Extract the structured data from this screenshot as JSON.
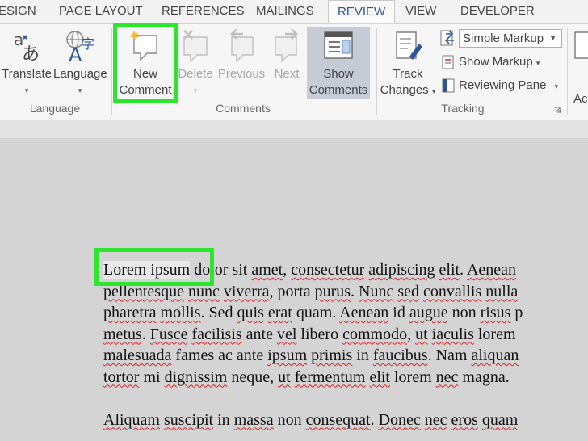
{
  "tabs": [
    "ESIGN",
    "PAGE LAYOUT",
    "REFERENCES",
    "MAILINGS",
    "REVIEW",
    "VIEW",
    "DEVELOPER"
  ],
  "active_tab": "REVIEW",
  "ribbon": {
    "language_group": {
      "label": "Language",
      "translate": "Translate",
      "language": "Language"
    },
    "comments_group": {
      "label": "Comments",
      "new_comment_line1": "New",
      "new_comment_line2": "Comment",
      "delete": "Delete",
      "previous": "Previous",
      "next": "Next",
      "show_comments_line1": "Show",
      "show_comments_line2": "Comments"
    },
    "tracking_group": {
      "label": "Tracking",
      "track_changes_line1": "Track",
      "track_changes_line2": "Changes",
      "markup_dropdown": "Simple Markup",
      "show_markup": "Show Markup",
      "reviewing_pane": "Reviewing Pane"
    },
    "cut_off_button": "Ac"
  },
  "document": {
    "paragraph1": [
      [
        {
          "t": "Lorem ipsum",
          "sel": true
        },
        {
          "t": " dolor sit "
        },
        {
          "t": "amet",
          "sq": true
        },
        {
          "t": ", "
        },
        {
          "t": "consectetur",
          "sq": true
        },
        {
          "t": " "
        },
        {
          "t": "adipiscing",
          "sq": true
        },
        {
          "t": " "
        },
        {
          "t": "elit",
          "sq": true
        },
        {
          "t": ". "
        },
        {
          "t": "Aenean",
          "sq": true
        }
      ],
      [
        {
          "t": "pellentesque",
          "sq": true
        },
        {
          "t": " "
        },
        {
          "t": "nunc",
          "sq": true
        },
        {
          "t": " "
        },
        {
          "t": "viverra",
          "sq": true
        },
        {
          "t": ", porta "
        },
        {
          "t": "purus",
          "sq": true
        },
        {
          "t": ". "
        },
        {
          "t": "Nunc",
          "sq": true
        },
        {
          "t": " "
        },
        {
          "t": "sed",
          "sq": true
        },
        {
          "t": " "
        },
        {
          "t": "convallis",
          "sq": true
        },
        {
          "t": " "
        },
        {
          "t": "nulla",
          "sq": true
        }
      ],
      [
        {
          "t": "pharetra",
          "sq": true
        },
        {
          "t": " "
        },
        {
          "t": "mollis",
          "sq": true
        },
        {
          "t": ". Sed "
        },
        {
          "t": "quis",
          "sq": true
        },
        {
          "t": " "
        },
        {
          "t": "erat",
          "sq": true
        },
        {
          "t": " quam. "
        },
        {
          "t": "Aenean",
          "sq": true
        },
        {
          "t": " id "
        },
        {
          "t": "augue",
          "sq": true
        },
        {
          "t": " non "
        },
        {
          "t": "risus",
          "sq": true
        },
        {
          "t": " p"
        }
      ],
      [
        {
          "t": "metus",
          "sq": true
        },
        {
          "t": ". "
        },
        {
          "t": "Fusce",
          "sq": true
        },
        {
          "t": " "
        },
        {
          "t": "facilisis",
          "sq": true
        },
        {
          "t": " ante "
        },
        {
          "t": "vel",
          "sq": true
        },
        {
          "t": " libero "
        },
        {
          "t": "commodo",
          "sq": true
        },
        {
          "t": ", "
        },
        {
          "t": "ut",
          "sq": true
        },
        {
          "t": " "
        },
        {
          "t": "iaculis",
          "sq": true
        },
        {
          "t": " lorem"
        }
      ],
      [
        {
          "t": "malesuada",
          "sq": true
        },
        {
          "t": " fames ac ante "
        },
        {
          "t": "ipsum",
          "sq": true
        },
        {
          "t": " "
        },
        {
          "t": "primis",
          "sq": true
        },
        {
          "t": " in "
        },
        {
          "t": "faucibus",
          "sq": true
        },
        {
          "t": ". Nam "
        },
        {
          "t": "aliquan",
          "sq": true
        }
      ],
      [
        {
          "t": "tortor",
          "sq": true
        },
        {
          "t": " mi "
        },
        {
          "t": "dignissim",
          "sq": true
        },
        {
          "t": " neque, "
        },
        {
          "t": "ut",
          "sq": true
        },
        {
          "t": " "
        },
        {
          "t": "fermentum",
          "sq": true
        },
        {
          "t": " "
        },
        {
          "t": "elit",
          "sq": true
        },
        {
          "t": " lorem "
        },
        {
          "t": "nec",
          "sq": true
        },
        {
          "t": " magna."
        }
      ]
    ],
    "paragraph2": [
      [
        {
          "t": "Aliquam",
          "sq": true
        },
        {
          "t": " "
        },
        {
          "t": "suscipit",
          "sq": true
        },
        {
          "t": " in "
        },
        {
          "t": "massa",
          "sq": true
        },
        {
          "t": " non "
        },
        {
          "t": "consequat",
          "sq": true
        },
        {
          "t": ". "
        },
        {
          "t": "Donec",
          "sq": true
        },
        {
          "t": " "
        },
        {
          "t": "nec",
          "sq": true
        },
        {
          "t": " "
        },
        {
          "t": "eros",
          "sq": true
        },
        {
          "t": " "
        },
        {
          "t": "quam",
          "sq": true
        }
      ]
    ]
  },
  "colors": {
    "highlight": "#2ee52e",
    "accent": "#2b579a",
    "spellcheck": "#e02020"
  }
}
